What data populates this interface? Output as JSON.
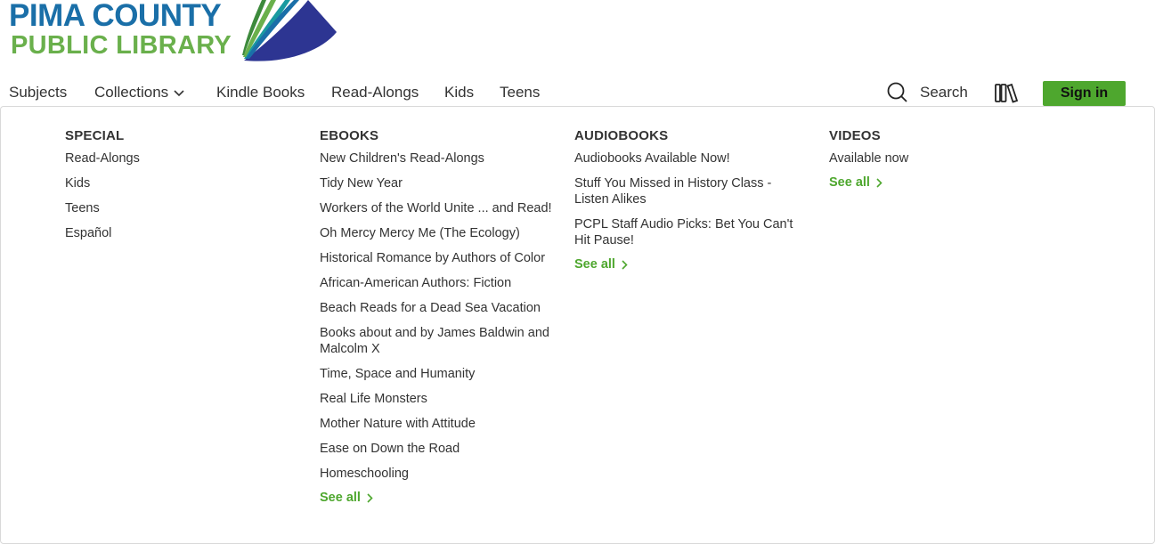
{
  "logo": {
    "line1": "PIMA COUNTY",
    "line2": "PUBLIC LIBRARY",
    "colors": {
      "blue": "#1a6fa8",
      "green": "#6ab04c",
      "navy": "#2d3592",
      "teal": "#1a9aa0"
    }
  },
  "nav": {
    "items": [
      {
        "label": "Subjects"
      },
      {
        "label": "Collections"
      },
      {
        "label": "Kindle Books"
      },
      {
        "label": "Read-Alongs"
      },
      {
        "label": "Kids"
      },
      {
        "label": "Teens"
      }
    ],
    "search_label": "Search",
    "shelf_icon": "library-shelf-icon",
    "signin_label": "Sign in"
  },
  "accent_color": "#4ea72e",
  "menu": {
    "columns": [
      {
        "title": "SPECIAL",
        "items": [
          "Read-Alongs",
          "Kids",
          "Teens",
          "Español"
        ],
        "see_all": ""
      },
      {
        "title": "EBOOKS",
        "items": [
          "New Children's Read-Alongs",
          "Tidy New Year",
          "Workers of the World Unite ... and Read!",
          "Oh Mercy Mercy Me (The Ecology)",
          "Historical Romance by Authors of Color",
          "African-American Authors: Fiction",
          "Beach Reads for a Dead Sea Vacation",
          "Books about and by James Baldwin and Malcolm X",
          "Time, Space and Humanity",
          "Real Life Monsters",
          "Mother Nature with Attitude",
          "Ease on Down the Road",
          "Homeschooling"
        ],
        "see_all": "See all"
      },
      {
        "title": "AUDIOBOOKS",
        "items": [
          "Audiobooks Available Now!",
          "Stuff You Missed in History Class - Listen Alikes",
          "PCPL Staff Audio Picks: Bet You Can't Hit Pause!"
        ],
        "see_all": "See all"
      },
      {
        "title": "VIDEOS",
        "items": [
          "Available now"
        ],
        "see_all": "See all"
      }
    ]
  }
}
